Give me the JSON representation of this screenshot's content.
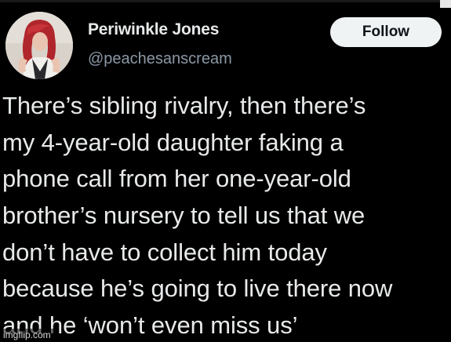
{
  "author": {
    "display_name": "Periwinkle Jones",
    "handle": "@peachesanscream",
    "avatar": "profile-photo"
  },
  "follow_button": {
    "label": "Follow"
  },
  "tweet": {
    "lines": [
      "There’s sibling rivalry, then there’s",
      "my 4-year-old daughter faking a",
      "phone call from her one-year-old",
      "brother’s nursery to tell us that we",
      "don’t have to collect him today",
      "because he’s going to live there now",
      "and he ‘won’t even miss us’"
    ]
  },
  "watermark": {
    "text": "imgflip.com"
  },
  "colors": {
    "background": "#000000",
    "text_primary": "#e7e9ea",
    "text_secondary": "#8b98a5",
    "follow_button_bg": "#eff3f4",
    "follow_button_text": "#0f1419"
  }
}
